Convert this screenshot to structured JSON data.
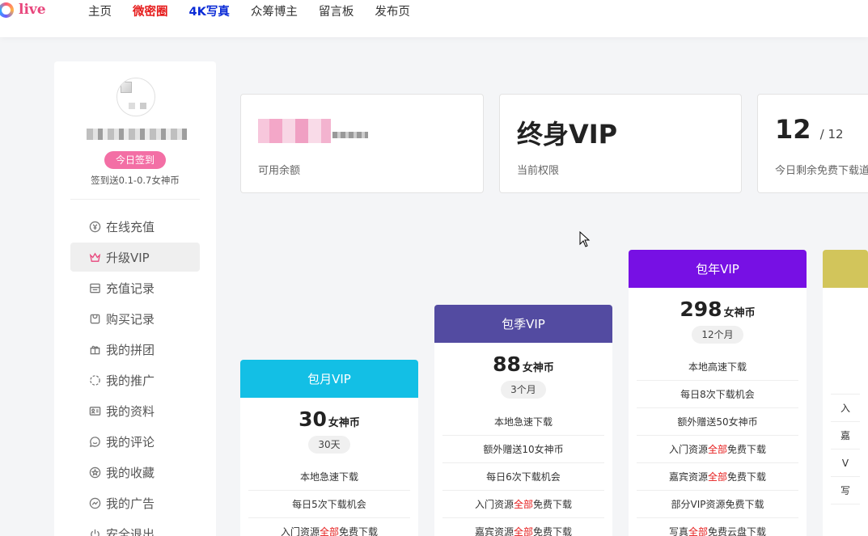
{
  "header": {
    "logo_text": "live",
    "nav": [
      {
        "label": "主页",
        "style": "normal"
      },
      {
        "label": "微密圈",
        "style": "red"
      },
      {
        "label": "4K写真",
        "style": "blue"
      },
      {
        "label": "众筹博主",
        "style": "normal"
      },
      {
        "label": "留言板",
        "style": "normal"
      },
      {
        "label": "发布页",
        "style": "normal"
      }
    ]
  },
  "sidebar": {
    "sign_button": "今日签到",
    "sign_note": "签到送0.1-0.7女神币",
    "items": [
      {
        "label": "在线充值",
        "icon": "coin-icon"
      },
      {
        "label": "升级VIP",
        "icon": "crown-icon",
        "active": true
      },
      {
        "label": "充值记录",
        "icon": "receipt-icon"
      },
      {
        "label": "购买记录",
        "icon": "bag-icon"
      },
      {
        "label": "我的拼团",
        "icon": "gift-icon"
      },
      {
        "label": "我的推广",
        "icon": "share-icon"
      },
      {
        "label": "我的资料",
        "icon": "id-card-icon"
      },
      {
        "label": "我的评论",
        "icon": "comment-icon"
      },
      {
        "label": "我的收藏",
        "icon": "star-icon"
      },
      {
        "label": "我的广告",
        "icon": "chart-icon"
      },
      {
        "label": "安全退出",
        "icon": "power-icon"
      }
    ]
  },
  "stats": {
    "balance_label": "可用余额",
    "permission_value": "终身VIP",
    "permission_label": "当前权限",
    "downloads_value": "12",
    "downloads_total": "/ 12",
    "downloads_label": "今日剩余免费下载道"
  },
  "plans": [
    {
      "name": "包月VIP",
      "color": "#13bfe5",
      "price": "30",
      "unit": "女神币",
      "duration": "30天",
      "features": [
        [
          {
            "t": "本地急速下载"
          }
        ],
        [
          {
            "t": "每日5次下载机会"
          }
        ],
        [
          {
            "t": "入门资源"
          },
          {
            "t": "全部",
            "hl": true
          },
          {
            "t": "免费下载"
          }
        ]
      ]
    },
    {
      "name": "包季VIP",
      "color": "#534ba1",
      "price": "88",
      "unit": "女神币",
      "duration": "3个月",
      "features": [
        [
          {
            "t": "本地急速下载"
          }
        ],
        [
          {
            "t": "额外赠送10女神币"
          }
        ],
        [
          {
            "t": "每日6次下载机会"
          }
        ],
        [
          {
            "t": "入门资源"
          },
          {
            "t": "全部",
            "hl": true
          },
          {
            "t": "免费下载"
          }
        ],
        [
          {
            "t": "嘉宾资源"
          },
          {
            "t": "全部",
            "hl": true
          },
          {
            "t": "免费下载"
          }
        ]
      ]
    },
    {
      "name": "包年VIP",
      "color": "#7710e4",
      "price": "298",
      "unit": "女神币",
      "duration": "12个月",
      "features": [
        [
          {
            "t": "本地高速下载"
          }
        ],
        [
          {
            "t": "每日8次下载机会"
          }
        ],
        [
          {
            "t": "额外赠送50女神币"
          }
        ],
        [
          {
            "t": "入门资源"
          },
          {
            "t": "全部",
            "hl": true
          },
          {
            "t": "免费下载"
          }
        ],
        [
          {
            "t": "嘉宾资源"
          },
          {
            "t": "全部",
            "hl": true
          },
          {
            "t": "免费下载"
          }
        ],
        [
          {
            "t": "部分VIP资源免费下载"
          }
        ],
        [
          {
            "t": "写真"
          },
          {
            "t": "全部",
            "hl": true
          },
          {
            "t": "免费云盘下载"
          }
        ]
      ]
    },
    {
      "name": "",
      "color": "#d2c55b",
      "price": "",
      "unit": "",
      "duration": "",
      "features": [
        [
          {
            "t": ""
          }
        ],
        [
          {
            "t": "入"
          }
        ],
        [
          {
            "t": "嘉"
          }
        ],
        [
          {
            "t": "V"
          }
        ],
        [
          {
            "t": "写"
          }
        ]
      ]
    }
  ]
}
